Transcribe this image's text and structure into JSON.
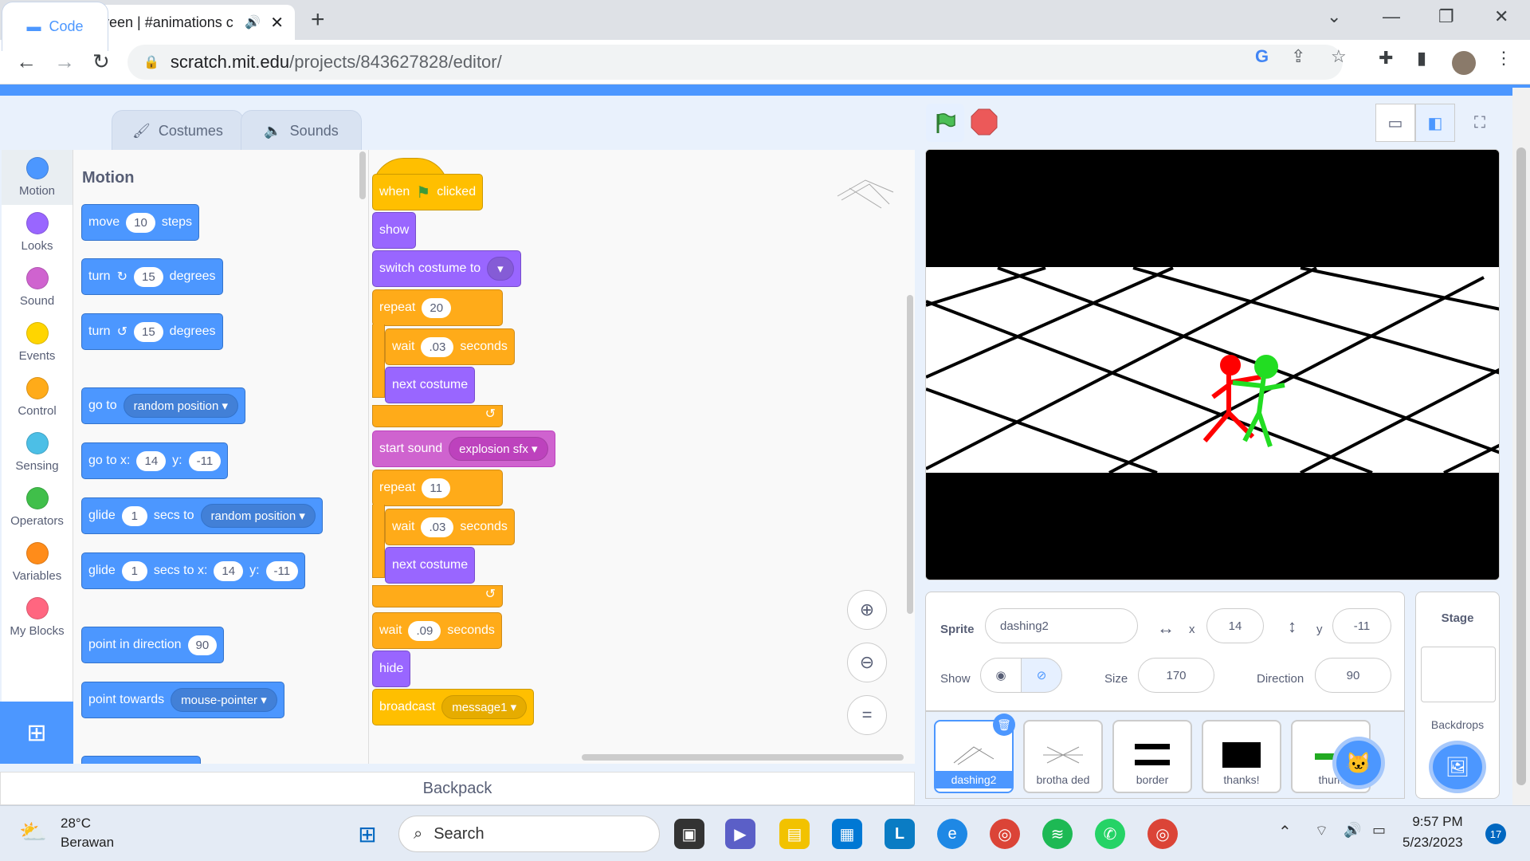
{
  "browser": {
    "tab_title": "Red vs Green | #animations c",
    "url_domain": "scratch.mit.edu",
    "url_path": "/projects/843627828/editor/"
  },
  "editor_tabs": [
    {
      "label": "Code"
    },
    {
      "label": "Costumes"
    },
    {
      "label": "Sounds"
    }
  ],
  "categories": [
    {
      "label": "Motion",
      "color": "#4c97ff"
    },
    {
      "label": "Looks",
      "color": "#9966ff"
    },
    {
      "label": "Sound",
      "color": "#cf63cf"
    },
    {
      "label": "Events",
      "color": "#ffd500"
    },
    {
      "label": "Control",
      "color": "#ffab19"
    },
    {
      "label": "Sensing",
      "color": "#4cbfe6"
    },
    {
      "label": "Operators",
      "color": "#40bf4a"
    },
    {
      "label": "Variables",
      "color": "#ff8c1a"
    },
    {
      "label": "My Blocks",
      "color": "#ff6680"
    }
  ],
  "palette": {
    "title": "Motion",
    "move": {
      "a": "move",
      "v": "10",
      "b": "steps"
    },
    "turn_right": {
      "a": "turn",
      "v": "15",
      "b": "degrees"
    },
    "turn_left": {
      "a": "turn",
      "v": "15",
      "b": "degrees"
    },
    "goto": {
      "a": "go to",
      "dd": "random position"
    },
    "goto_xy": {
      "a": "go to x:",
      "x": "14",
      "b": "y:",
      "y": "-11"
    },
    "glide": {
      "a": "glide",
      "v": "1",
      "b": "secs to",
      "dd": "random position"
    },
    "glide_xy": {
      "a": "glide",
      "v": "1",
      "b": "secs to x:",
      "x": "14",
      "c": "y:",
      "y": "-11"
    },
    "point_dir": {
      "a": "point in direction",
      "v": "90"
    },
    "point_towards": {
      "a": "point towards",
      "dd": "mouse-pointer"
    }
  },
  "script": {
    "when": "when",
    "clicked": "clicked",
    "show": "show",
    "switch_costume": "switch costume to",
    "repeat1": {
      "label": "repeat",
      "v": "20"
    },
    "wait1": {
      "a": "wait",
      "v": ".03",
      "b": "seconds"
    },
    "next1": "next costume",
    "start_sound": {
      "a": "start sound",
      "dd": "explosion sfx"
    },
    "repeat2": {
      "label": "repeat",
      "v": "11"
    },
    "wait2": {
      "a": "wait",
      "v": ".03",
      "b": "seconds"
    },
    "next2": "next costume",
    "wait3": {
      "a": "wait",
      "v": ".09",
      "b": "seconds"
    },
    "hide": "hide",
    "broadcast": {
      "a": "broadcast",
      "dd": "message1"
    }
  },
  "backpack": "Backpack",
  "sprite_info": {
    "sprite_label": "Sprite",
    "sprite_name": "dashing2",
    "x_label": "x",
    "x": "14",
    "y_label": "y",
    "y": "-11",
    "show_label": "Show",
    "size_label": "Size",
    "size": "170",
    "direction_label": "Direction",
    "direction": "90"
  },
  "sprites": [
    {
      "name": "dashing2"
    },
    {
      "name": "brotha ded"
    },
    {
      "name": "border"
    },
    {
      "name": "thanks!"
    },
    {
      "name": "thum"
    }
  ],
  "stage_panel": {
    "title": "Stage",
    "backdrops": "Backdrops"
  },
  "taskbar": {
    "temp": "28°C",
    "weather": "Berawan",
    "search": "Search",
    "time": "9:57 PM",
    "date": "5/23/2023",
    "notifications": "17"
  }
}
